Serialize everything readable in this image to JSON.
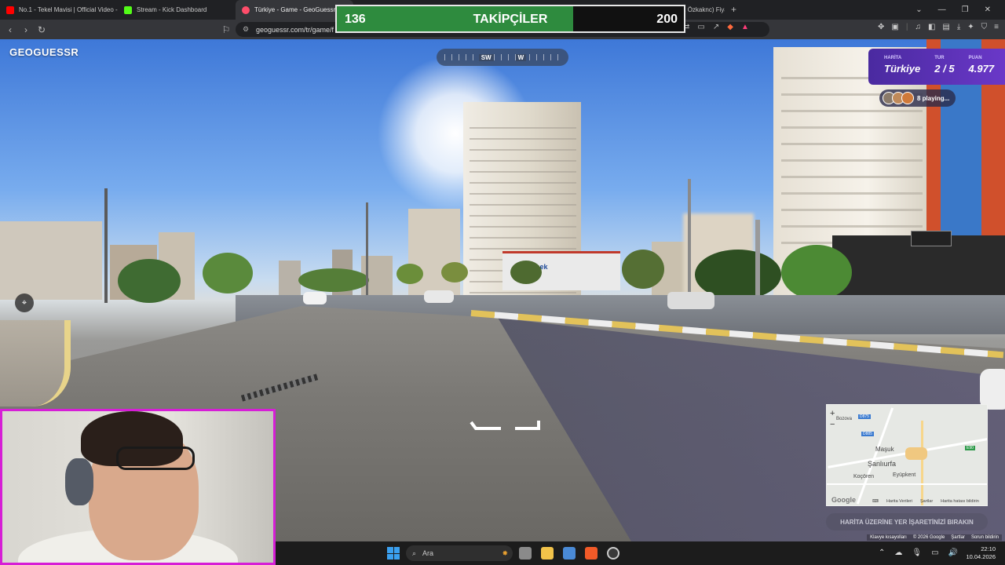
{
  "browser": {
    "tabs": [
      {
        "title": "No.1 - Tekel Mavisi | Official Video - ",
        "favicon_color": "#ff0000",
        "active": false
      },
      {
        "title": "Stream - Kick Dashboard",
        "favicon_color": "#53fc18",
        "active": false
      },
      {
        "title": "Türkiye - Game - GeoGuessr",
        "favicon_color": "#ff4d6a",
        "active": true
      },
      {
        "title": "İblisin Kıblesi (Cengiz Özkaknc) Fiyatı",
        "favicon_color": "#f2c400",
        "active": false
      }
    ],
    "new_tab": "+",
    "url": "geoguessr.com/tr/game/f"
  },
  "follower_goal": {
    "current": "136",
    "label": "TAKİPÇİLER",
    "goal": "200",
    "progress_fraction": 0.68
  },
  "game": {
    "logo": "GEOGUESSR",
    "compass": {
      "left": "SW",
      "right": "W"
    },
    "hud": {
      "map_label": "HARİTA",
      "map_value": "Türkiye",
      "round_label": "TUR",
      "round_value": "2 / 5",
      "score_label": "PUAN",
      "score_value": "4.977"
    },
    "players": "8 playing...",
    "guess_button": "HARİTA ÜZERİNE YER İŞARETİNİZİ BIRAKIN",
    "minimap": {
      "cities": [
        "Maşuk",
        "Şanlıurfa",
        "Koçören",
        "Eyüpkent",
        "Bahçeli",
        "Bozova"
      ],
      "road_badges": [
        "D875",
        "D885",
        "E90"
      ],
      "zoom_in": "+",
      "zoom_out": "−",
      "footer": [
        "Klavye kısayolları",
        "Harita Verileri",
        "Şartlar",
        "Harita hatası bildirin"
      ],
      "google": "Google"
    },
    "scene_footer": [
      "Klavye kısayolları",
      "© 2026 Google",
      "Şartlar",
      "Sorun bildirin"
    ],
    "sign": "bek"
  },
  "taskbar": {
    "search_placeholder": "Ara",
    "time": "22:10",
    "date": "10.04.2026"
  },
  "colors": {
    "accent_purple": "#6a38c8",
    "follower_green": "#2e8b3e",
    "webcam_border": "#d61ed6"
  }
}
